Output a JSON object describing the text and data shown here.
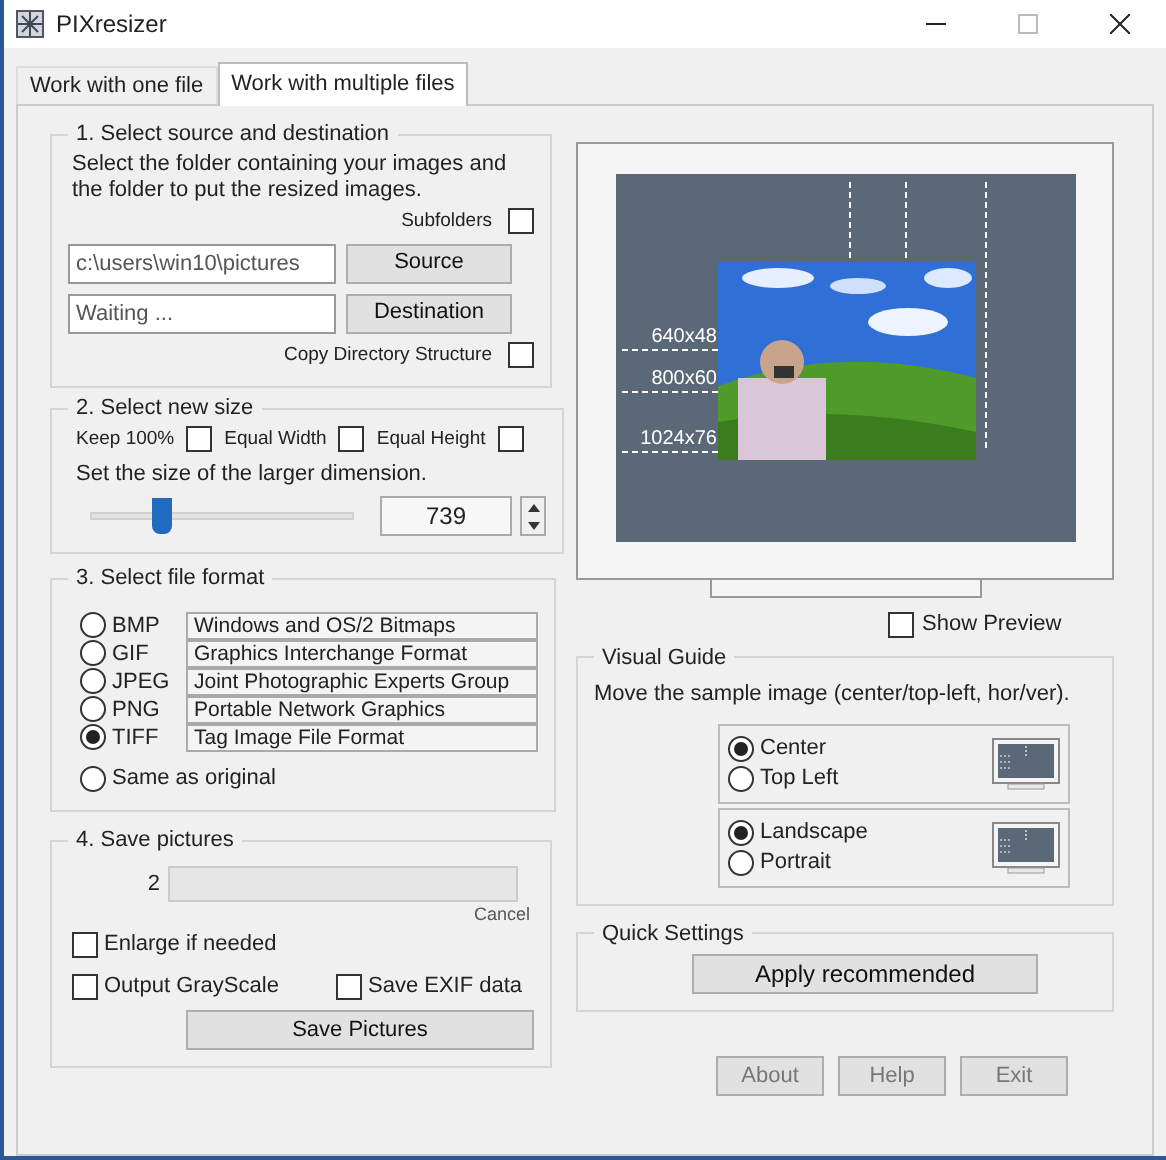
{
  "window": {
    "title": "PIXresizer"
  },
  "tabs": [
    {
      "label": "Work with one file",
      "selected": false
    },
    {
      "label": "Work with multiple files",
      "selected": true
    }
  ],
  "source_group": {
    "title": "1. Select source and destination",
    "description": "Select the folder containing your images and the folder to put the resized images.",
    "subfolders": {
      "label": "Subfolders",
      "checked": false
    },
    "source_field": {
      "value": "c:\\users\\win10\\pictures"
    },
    "source_button": "Source",
    "destination_field": {
      "value": "Waiting ..."
    },
    "destination_button": "Destination",
    "copy_structure": {
      "label": "Copy Directory Structure",
      "checked": false
    }
  },
  "size_group": {
    "title": "2. Select new size",
    "options": [
      {
        "label": "Keep 100%",
        "checked": false
      },
      {
        "label": "Equal Width",
        "checked": false
      },
      {
        "label": "Equal Height",
        "checked": false
      }
    ],
    "instruction": "Set the size of the larger dimension.",
    "slider": {
      "level": 0.27
    },
    "size_value": "739"
  },
  "format_group": {
    "title": "3. Select file format",
    "formats": [
      {
        "label": "BMP",
        "description": "Windows and OS/2 Bitmaps",
        "selected": false
      },
      {
        "label": "GIF",
        "description": "Graphics Interchange Format",
        "selected": false
      },
      {
        "label": "JPEG",
        "description": "Joint Photographic Experts Group",
        "selected": false
      },
      {
        "label": "PNG",
        "description": "Portable Network Graphics",
        "selected": false
      },
      {
        "label": "TIFF",
        "description": "Tag Image File Format",
        "selected": true
      }
    ],
    "same_as_original": {
      "label": "Same as original",
      "selected": false
    }
  },
  "save_group": {
    "title": "4. Save pictures",
    "count": "2",
    "progress": {
      "level": 0
    },
    "cancel": "Cancel",
    "options": [
      {
        "label": "Enlarge if needed",
        "checked": false
      },
      {
        "label": "Output GrayScale",
        "checked": false
      },
      {
        "label": "Save EXIF data",
        "checked": false
      }
    ],
    "save_button": "Save Pictures"
  },
  "preview": {
    "size_labels": [
      "640x48",
      "800x60",
      "1024x76"
    ],
    "show_preview": {
      "label": "Show Preview",
      "checked": false
    }
  },
  "visual_guide": {
    "title": "Visual Guide",
    "description": "Move the sample image (center/top-left, hor/ver).",
    "position": [
      {
        "label": "Center",
        "selected": true
      },
      {
        "label": "Top Left",
        "selected": false
      }
    ],
    "orientation": [
      {
        "label": "Landscape",
        "selected": true
      },
      {
        "label": "Portrait",
        "selected": false
      }
    ]
  },
  "quick_settings": {
    "title": "Quick Settings",
    "button": "Apply recommended"
  },
  "buttons": [
    "About",
    "Help",
    "Exit"
  ]
}
